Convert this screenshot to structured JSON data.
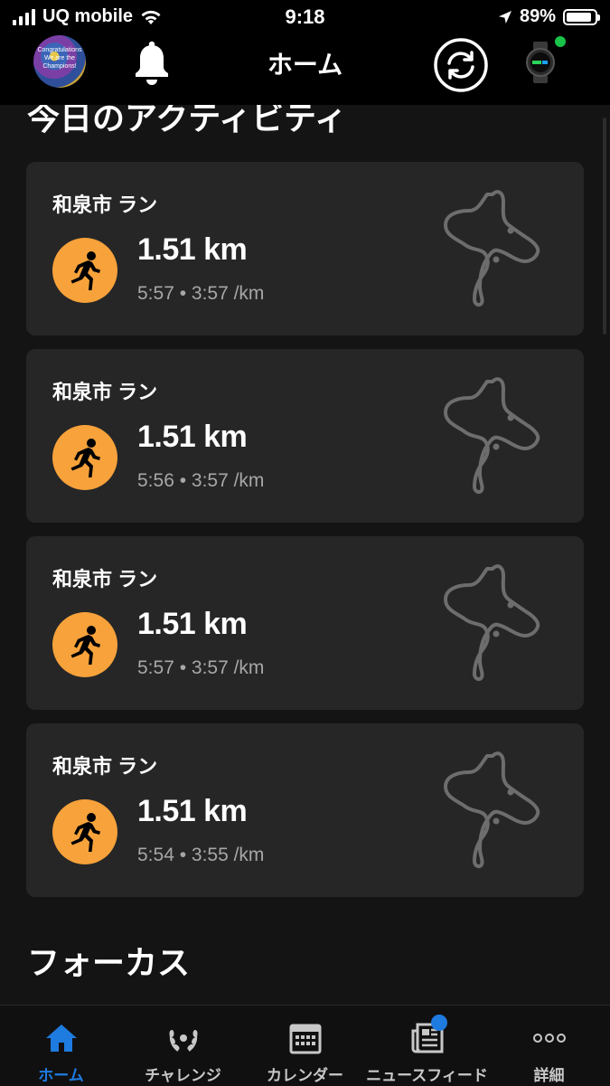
{
  "status": {
    "carrier": "UQ mobile",
    "time": "9:18",
    "battery": "89%",
    "battery_level": 0.89
  },
  "header": {
    "title": "ホーム",
    "avatar_text": "Congratulations We are the Champions!",
    "icons": [
      "bell-icon",
      "sync-icon",
      "watch-icon"
    ],
    "watch_connected_color": "#19c34a"
  },
  "activities": {
    "title": "今日のアクティビティ",
    "items": [
      {
        "name": "和泉市 ラン",
        "distance": "1.51 km",
        "details": "5:57 • 3:57 /km"
      },
      {
        "name": "和泉市 ラン",
        "distance": "1.51 km",
        "details": "5:56 • 3:57 /km"
      },
      {
        "name": "和泉市 ラン",
        "distance": "1.51 km",
        "details": "5:57 • 3:57 /km"
      },
      {
        "name": "和泉市 ラン",
        "distance": "1.51 km",
        "details": "5:54 • 3:55 /km"
      }
    ]
  },
  "focus": {
    "title": "フォーカス"
  },
  "tabbar": {
    "items": [
      {
        "label": "ホーム",
        "icon": "home-icon",
        "active": true
      },
      {
        "label": "チャレンジ",
        "icon": "laurel-icon",
        "active": false
      },
      {
        "label": "カレンダー",
        "icon": "calendar-icon",
        "active": false
      },
      {
        "label": "ニュースフィード",
        "icon": "newsfeed-icon",
        "active": false
      },
      {
        "label": "詳細",
        "icon": "more-icon",
        "active": false
      }
    ]
  },
  "colors": {
    "accent": "#1e7be0",
    "activity_icon": "#f7a23b",
    "card": "#262626",
    "background": "#141414"
  }
}
